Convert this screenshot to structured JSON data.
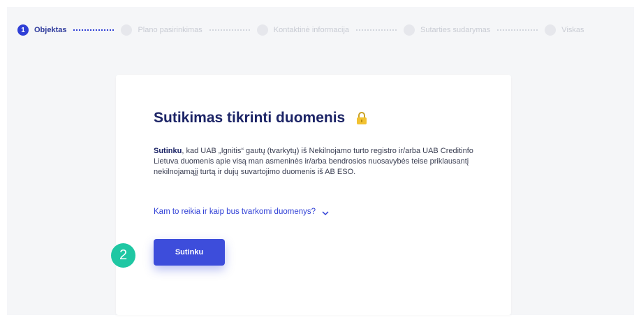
{
  "stepper": {
    "steps": [
      {
        "number": "1",
        "label": "Objektas",
        "active": true
      },
      {
        "number": "",
        "label": "Plano pasirinkimas",
        "active": false
      },
      {
        "number": "",
        "label": "Kontaktinė informacija",
        "active": false
      },
      {
        "number": "",
        "label": "Sutarties sudarymas",
        "active": false
      },
      {
        "number": "",
        "label": "Viskas",
        "active": false
      }
    ]
  },
  "consent": {
    "title": "Sutikimas tikrinti duomenis",
    "lock_icon": "lock-icon",
    "body_bold": "Sutinku",
    "body_text": ", kad UAB „Ignitis“ gautų (tvarkytų) iš Nekilnojamo turto registro ir/arba UAB Creditinfo Lietuva duomenis apie visą man asmeninės ir/arba bendrosios nuosavybės teise priklausantį nekilnojamąjį turtą ir dujų suvartojimo duomenis iš AB ESO.",
    "expand_link": "Kam to reikia ir kaip bus tvarkomi duomenys?",
    "agree_button": "Sutinku"
  },
  "annotation": {
    "marker": "2"
  },
  "colors": {
    "accent": "#3d4ddb",
    "title": "#1c2466",
    "marker": "#1fc7a3"
  }
}
